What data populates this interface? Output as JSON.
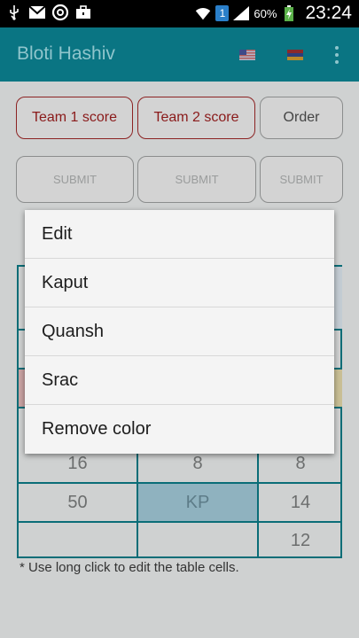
{
  "status_bar": {
    "icons": [
      "usb-icon",
      "gmail-icon",
      "email-at-icon",
      "briefcase-icon"
    ],
    "sim": "1",
    "battery": "60%",
    "time": "23:24"
  },
  "app": {
    "title": "Bloti Hashiv",
    "language_flags": [
      "us-flag",
      "armenia-flag"
    ]
  },
  "buttons": {
    "team1": "Team 1 score",
    "team2": "Team 2 score",
    "order": "Order",
    "submit": "SUBMIT"
  },
  "table": {
    "visible_rows": [
      [
        "16",
        "8",
        "8"
      ],
      [
        "50",
        "KP",
        "14"
      ],
      [
        "",
        "",
        "12"
      ]
    ]
  },
  "note": "* Use long click to edit the table cells.",
  "context_menu": {
    "items": [
      "Edit",
      "Kaput",
      "Quansh",
      "Srac",
      "Remove color"
    ]
  },
  "colors": {
    "action_bar": "#0a7583",
    "grid_border": "#0a6d77",
    "team_button_border": "#8c2323",
    "highlight_cell": "#8fb2bf"
  }
}
